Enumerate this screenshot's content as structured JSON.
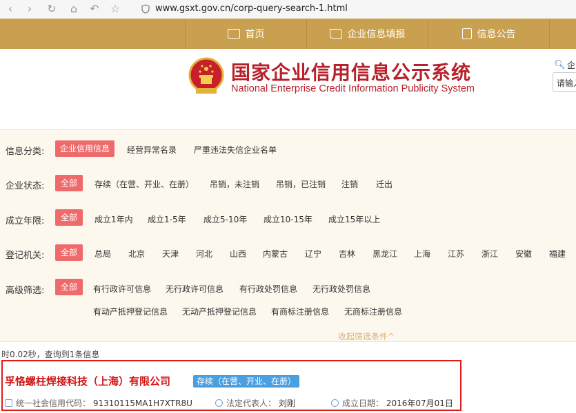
{
  "browser": {
    "url": "www.gsxt.gov.cn/corp-query-search-1.html"
  },
  "topnav": {
    "items": [
      {
        "label": "首页",
        "icon": "monitor-icon"
      },
      {
        "label": "企业信息填报",
        "icon": "edit-icon"
      },
      {
        "label": "信息公告",
        "icon": "document-icon"
      }
    ]
  },
  "header": {
    "title_cn": "国家企业信用信息公示系统",
    "title_en": "National Enterprise Credit Information Publicity System",
    "search_label": "企",
    "search_placeholder": "请输入"
  },
  "filters": {
    "category": {
      "label": "信息分类:",
      "options": [
        "企业信用信息",
        "经营异常名录",
        "严重违法失信企业名单"
      ]
    },
    "status": {
      "label": "企业状态:",
      "options": [
        "全部",
        "存续（在营、开业、在册）",
        "吊销，未注销",
        "吊销，已注销",
        "注销",
        "迁出"
      ]
    },
    "years": {
      "label": "成立年限:",
      "options": [
        "全部",
        "成立1年内",
        "成立1-5年",
        "成立5-10年",
        "成立10-15年",
        "成立15年以上"
      ]
    },
    "authority": {
      "label": "登记机关:",
      "options": [
        "全部",
        "总局",
        "北京",
        "天津",
        "河北",
        "山西",
        "内蒙古",
        "辽宁",
        "吉林",
        "黑龙江",
        "上海",
        "江苏",
        "浙江",
        "安徽",
        "福建"
      ]
    },
    "advanced": {
      "label": "高级筛选:",
      "options": [
        "全部",
        "有行政许可信息",
        "无行政许可信息",
        "有行政处罚信息",
        "无行政处罚信息",
        "有动产抵押登记信息",
        "无动产抵押登记信息",
        "有商标注册信息",
        "无商标注册信息"
      ]
    },
    "collapse_label": "收起筛选条件^"
  },
  "result_stats": "时0.02秒，查询到1条信息",
  "result": {
    "name": "孚恪螺柱焊接科技（上海）有限公司",
    "status": "存续（在营、开业、在册）",
    "credit_code_label": "统一社会信用代码：",
    "credit_code": "91310115MA1H7XTR8U",
    "legal_rep_label": "法定代表人：",
    "legal_rep": "刘刚",
    "founded_label": "成立日期：",
    "founded": "2016年07月01日"
  }
}
